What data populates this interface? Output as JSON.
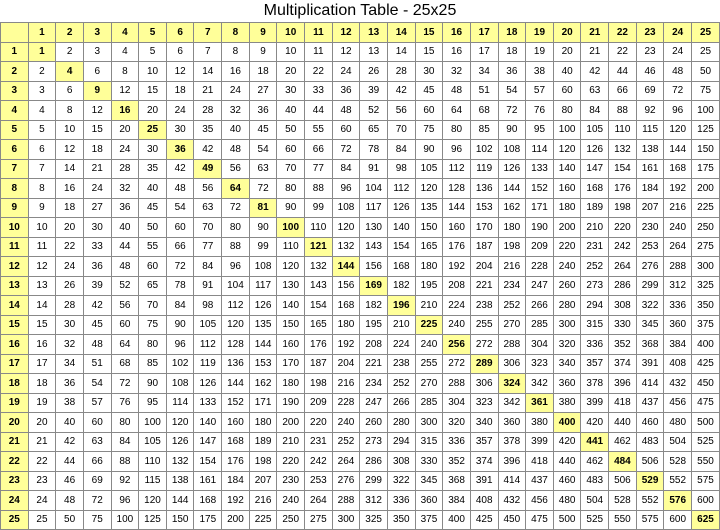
{
  "title": "Multiplication Table - 25x25",
  "chart_data": {
    "type": "table",
    "title": "Multiplication Table - 25x25",
    "size": 25,
    "row_headers": [
      1,
      2,
      3,
      4,
      5,
      6,
      7,
      8,
      9,
      10,
      11,
      12,
      13,
      14,
      15,
      16,
      17,
      18,
      19,
      20,
      21,
      22,
      23,
      24,
      25
    ],
    "col_headers": [
      1,
      2,
      3,
      4,
      5,
      6,
      7,
      8,
      9,
      10,
      11,
      12,
      13,
      14,
      15,
      16,
      17,
      18,
      19,
      20,
      21,
      22,
      23,
      24,
      25
    ],
    "values": [
      [
        1,
        2,
        3,
        4,
        5,
        6,
        7,
        8,
        9,
        10,
        11,
        12,
        13,
        14,
        15,
        16,
        17,
        18,
        19,
        20,
        21,
        22,
        23,
        24,
        25
      ],
      [
        2,
        4,
        6,
        8,
        10,
        12,
        14,
        16,
        18,
        20,
        22,
        24,
        26,
        28,
        30,
        32,
        34,
        36,
        38,
        40,
        42,
        44,
        46,
        48,
        50
      ],
      [
        3,
        6,
        9,
        12,
        15,
        18,
        21,
        24,
        27,
        30,
        33,
        36,
        39,
        42,
        45,
        48,
        51,
        54,
        57,
        60,
        63,
        66,
        69,
        72,
        75
      ],
      [
        4,
        8,
        12,
        16,
        20,
        24,
        28,
        32,
        36,
        40,
        44,
        48,
        52,
        56,
        60,
        64,
        68,
        72,
        76,
        80,
        84,
        88,
        92,
        96,
        100
      ],
      [
        5,
        10,
        15,
        20,
        25,
        30,
        35,
        40,
        45,
        50,
        55,
        60,
        65,
        70,
        75,
        80,
        85,
        90,
        95,
        100,
        105,
        110,
        115,
        120,
        125
      ],
      [
        6,
        12,
        18,
        24,
        30,
        36,
        42,
        48,
        54,
        60,
        66,
        72,
        78,
        84,
        90,
        96,
        102,
        108,
        114,
        120,
        126,
        132,
        138,
        144,
        150
      ],
      [
        7,
        14,
        21,
        28,
        35,
        42,
        49,
        56,
        63,
        70,
        77,
        84,
        91,
        98,
        105,
        112,
        119,
        126,
        133,
        140,
        147,
        154,
        161,
        168,
        175
      ],
      [
        8,
        16,
        24,
        32,
        40,
        48,
        56,
        64,
        72,
        80,
        88,
        96,
        104,
        112,
        120,
        128,
        136,
        144,
        152,
        160,
        168,
        176,
        184,
        192,
        200
      ],
      [
        9,
        18,
        27,
        36,
        45,
        54,
        63,
        72,
        81,
        90,
        99,
        108,
        117,
        126,
        135,
        144,
        153,
        162,
        171,
        180,
        189,
        198,
        207,
        216,
        225
      ],
      [
        10,
        20,
        30,
        40,
        50,
        60,
        70,
        80,
        90,
        100,
        110,
        120,
        130,
        140,
        150,
        160,
        170,
        180,
        190,
        200,
        210,
        220,
        230,
        240,
        250
      ],
      [
        11,
        22,
        33,
        44,
        55,
        66,
        77,
        88,
        99,
        110,
        121,
        132,
        143,
        154,
        165,
        176,
        187,
        198,
        209,
        220,
        231,
        242,
        253,
        264,
        275
      ],
      [
        12,
        24,
        36,
        48,
        60,
        72,
        84,
        96,
        108,
        120,
        132,
        144,
        156,
        168,
        180,
        192,
        204,
        216,
        228,
        240,
        252,
        264,
        276,
        288,
        300
      ],
      [
        13,
        26,
        39,
        52,
        65,
        78,
        91,
        104,
        117,
        130,
        143,
        156,
        169,
        182,
        195,
        208,
        221,
        234,
        247,
        260,
        273,
        286,
        299,
        312,
        325
      ],
      [
        14,
        28,
        42,
        56,
        70,
        84,
        98,
        112,
        126,
        140,
        154,
        168,
        182,
        196,
        210,
        224,
        238,
        252,
        266,
        280,
        294,
        308,
        322,
        336,
        350
      ],
      [
        15,
        30,
        45,
        60,
        75,
        90,
        105,
        120,
        135,
        150,
        165,
        180,
        195,
        210,
        225,
        240,
        255,
        270,
        285,
        300,
        315,
        330,
        345,
        360,
        375
      ],
      [
        16,
        32,
        48,
        64,
        80,
        96,
        112,
        128,
        144,
        160,
        176,
        192,
        208,
        224,
        240,
        256,
        272,
        288,
        304,
        320,
        336,
        352,
        368,
        384,
        400
      ],
      [
        17,
        34,
        51,
        68,
        85,
        102,
        119,
        136,
        153,
        170,
        187,
        204,
        221,
        238,
        255,
        272,
        289,
        306,
        323,
        340,
        357,
        374,
        391,
        408,
        425
      ],
      [
        18,
        36,
        54,
        72,
        90,
        108,
        126,
        144,
        162,
        180,
        198,
        216,
        234,
        252,
        270,
        288,
        306,
        324,
        342,
        360,
        378,
        396,
        414,
        432,
        450
      ],
      [
        19,
        38,
        57,
        76,
        95,
        114,
        133,
        152,
        171,
        190,
        209,
        228,
        247,
        266,
        285,
        304,
        323,
        342,
        361,
        380,
        399,
        418,
        437,
        456,
        475
      ],
      [
        20,
        40,
        60,
        80,
        100,
        120,
        140,
        160,
        180,
        200,
        220,
        240,
        260,
        280,
        300,
        320,
        340,
        360,
        380,
        400,
        420,
        440,
        460,
        480,
        500
      ],
      [
        21,
        42,
        63,
        84,
        105,
        126,
        147,
        168,
        189,
        210,
        231,
        252,
        273,
        294,
        315,
        336,
        357,
        378,
        399,
        420,
        441,
        462,
        483,
        504,
        525
      ],
      [
        22,
        44,
        66,
        88,
        110,
        132,
        154,
        176,
        198,
        220,
        242,
        264,
        286,
        308,
        330,
        352,
        374,
        396,
        418,
        440,
        462,
        484,
        506,
        528,
        550
      ],
      [
        23,
        46,
        69,
        92,
        115,
        138,
        161,
        184,
        207,
        230,
        253,
        276,
        299,
        322,
        345,
        368,
        391,
        414,
        437,
        460,
        483,
        506,
        529,
        552,
        575
      ],
      [
        24,
        48,
        72,
        96,
        120,
        144,
        168,
        192,
        216,
        240,
        264,
        288,
        312,
        336,
        360,
        384,
        408,
        432,
        456,
        480,
        504,
        528,
        552,
        576,
        600
      ],
      [
        25,
        50,
        75,
        100,
        125,
        150,
        175,
        200,
        225,
        250,
        275,
        300,
        325,
        350,
        375,
        400,
        425,
        450,
        475,
        500,
        525,
        550,
        575,
        600,
        625
      ]
    ]
  }
}
